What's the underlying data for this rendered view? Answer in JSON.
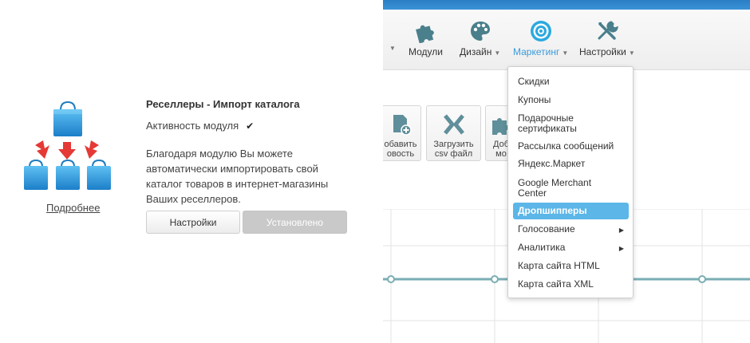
{
  "module": {
    "title": "Реселлеры - Импорт каталога",
    "activity_label": "Активность модуля",
    "activity_checked": true,
    "description": "Благодаря модулю Вы можете автоматически импортировать свой каталог товаров в интернет-магазины Ваших реселлеров.",
    "more_link": "Подробнее",
    "settings_button": "Настройки",
    "installed_button": "Установлено",
    "icons": [
      "shopping-bag-icon",
      "arrow-down-icon",
      "shopping-bag-icon"
    ]
  },
  "nav": {
    "items": [
      {
        "label": "Модули",
        "icon": "puzzle-icon",
        "has_caret": false,
        "active": false
      },
      {
        "label": "Дизайн",
        "icon": "palette-icon",
        "has_caret": true,
        "active": false
      },
      {
        "label": "Маркетинг",
        "icon": "target-icon",
        "has_caret": true,
        "active": true
      },
      {
        "label": "Настройки",
        "icon": "tools-icon",
        "has_caret": true,
        "active": false
      }
    ]
  },
  "toolbar": {
    "buttons": [
      {
        "label": "обавить\nовость",
        "icon": "add-document-icon"
      },
      {
        "label": "Загрузить\ncsv файл",
        "icon": "csv-upload-icon"
      },
      {
        "label": "Доб\nмо",
        "icon": "puzzle-icon"
      }
    ]
  },
  "marketing_menu": {
    "items": [
      {
        "label": "Скидки",
        "submenu": false,
        "selected": false
      },
      {
        "label": "Купоны",
        "submenu": false,
        "selected": false
      },
      {
        "label": "Подарочные сертификаты",
        "submenu": false,
        "selected": false
      },
      {
        "label": "Рассылка сообщений",
        "submenu": false,
        "selected": false
      },
      {
        "label": "Яндекс.Маркет",
        "submenu": false,
        "selected": false
      },
      {
        "label": "Google Merchant Center",
        "submenu": false,
        "selected": false
      },
      {
        "label": "Дропшипперы",
        "submenu": false,
        "selected": true
      },
      {
        "label": "Голосование",
        "submenu": true,
        "selected": false
      },
      {
        "label": "Аналитика",
        "submenu": true,
        "selected": false
      },
      {
        "label": "Карта сайта HTML",
        "submenu": false,
        "selected": false
      },
      {
        "label": "Карта сайта XML",
        "submenu": false,
        "selected": false
      }
    ]
  },
  "colors": {
    "accent": "#3a9ad9",
    "selected_bg": "#5cb6e8",
    "bag_blue": "#2f9be0",
    "arrow_red": "#e53935",
    "chart_line": "#7aaeb4"
  }
}
